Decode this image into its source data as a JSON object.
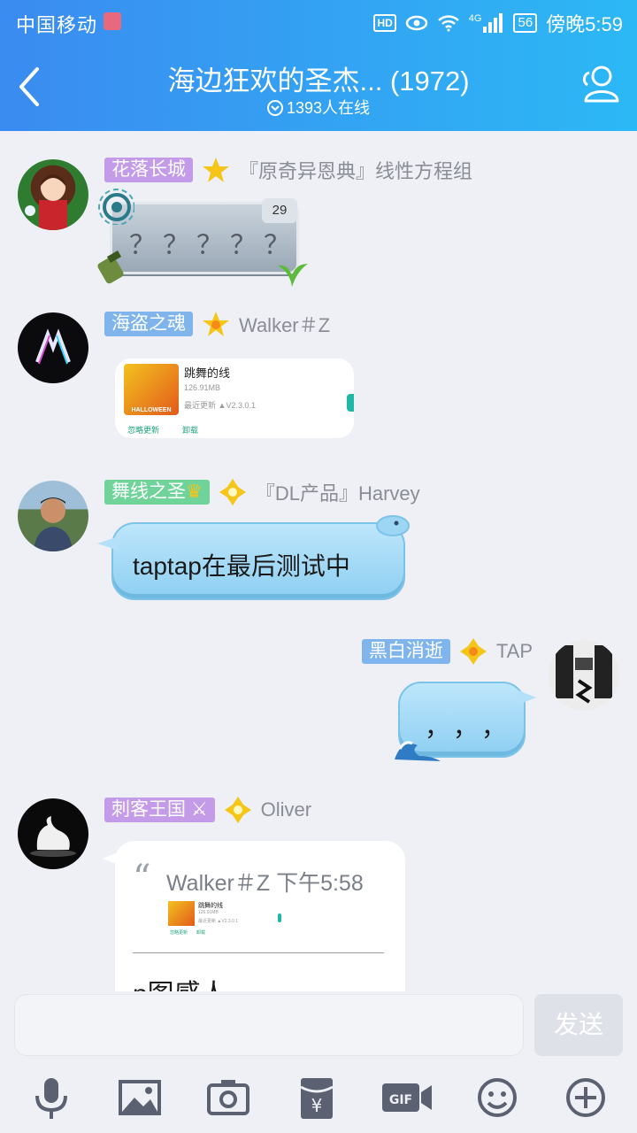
{
  "status_bar": {
    "carrier": "中国移动",
    "hd": "HD",
    "network": "4G",
    "battery": "56",
    "time": "傍晚5:59"
  },
  "nav": {
    "title": "海边狂欢的圣杰... (1972)",
    "online": "1393人在线"
  },
  "messages": [
    {
      "badge": "花落长城",
      "badge_color": "#c39be8",
      "name": "『原奇异恩典』线性方程组",
      "content": "？？？？？",
      "count": "29"
    },
    {
      "badge": "海盗之魂",
      "badge_color": "#7fb5ec",
      "name": "Walker＃Z",
      "card_title": "跳舞的线",
      "card_size": "126.91MB",
      "card_update": "最近更新",
      "card_version": "V2.3.0.1",
      "card_ignore": "忽略更新",
      "card_uninstall": "卸载",
      "card_banner": "HALLOWEEN"
    },
    {
      "badge": "舞线之圣",
      "badge_color": "#6fd39a",
      "name": "『DL产品』Harvey",
      "content": "taptap在最后测试中"
    },
    {
      "badge": "黑白消逝",
      "badge_color": "#7fb5ec",
      "name": "TAP",
      "content": "，，，"
    },
    {
      "badge": "刺客王国",
      "badge_color": "#c39be8",
      "name": "Oliver",
      "quote_header": "Walker＃Z 下午5:58",
      "quote_card_title": "跳舞的线",
      "quote_card_size": "126.91MB",
      "quote_card_update": "最近更新",
      "quote_card_version": "V2.3.0.1",
      "quote_card_ignore": "忽略更新",
      "quote_card_uninstall": "卸载",
      "content": "p图感人"
    }
  ],
  "input": {
    "placeholder": "",
    "send": "发送"
  },
  "toolbar": [
    "microphone-icon",
    "image-icon",
    "camera-icon",
    "red-packet-icon",
    "gif-icon",
    "emoji-icon",
    "plus-icon"
  ],
  "colors": {
    "header_start": "#3b8bf0",
    "header_end": "#2cb8f5",
    "background": "#eef0f6",
    "bubble_blue": "#a7dbf7",
    "star": "#f5c518"
  }
}
